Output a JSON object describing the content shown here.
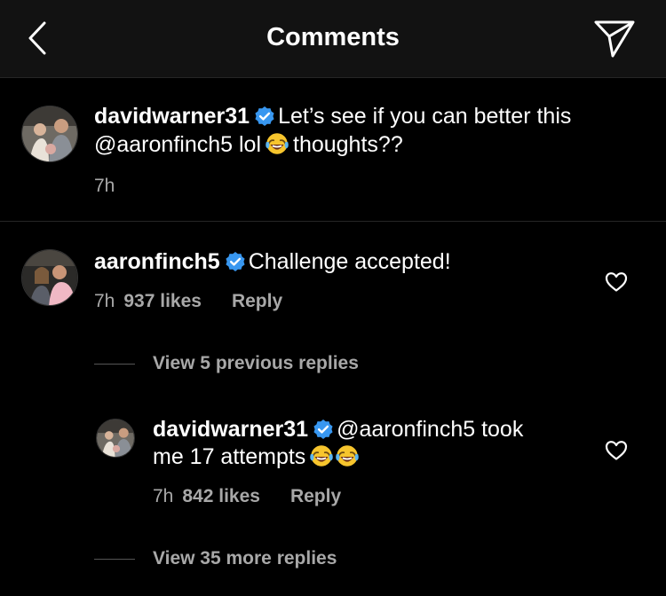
{
  "header": {
    "title": "Comments",
    "back_icon": "chevron-left-icon",
    "send_icon": "paper-plane-icon"
  },
  "caption": {
    "username": "davidwarner31",
    "text_line1": "Let’s see if you can better this",
    "mention": "@aaronfinch5",
    "text_mid": "lol",
    "text_end": "thoughts??",
    "emoji": "face-with-tears-of-joy",
    "time": "7h"
  },
  "comment": {
    "username": "aaronfinch5",
    "text": "Challenge accepted!",
    "time": "7h",
    "likes": "937 likes",
    "reply_label": "Reply"
  },
  "view_previous": "View 5 previous replies",
  "reply": {
    "username": "davidwarner31",
    "mention": "@aaronfinch5",
    "text_line1": "took",
    "text_line2": "me 17 attempts",
    "emoji": "face-with-tears-of-joy",
    "time": "7h",
    "likes": "842 likes",
    "reply_label": "Reply"
  },
  "view_more": "View 35 more replies",
  "colors": {
    "background": "#000000",
    "header": "#121212",
    "verified": "#3897f0",
    "secondary_text": "#a8a8a8"
  }
}
